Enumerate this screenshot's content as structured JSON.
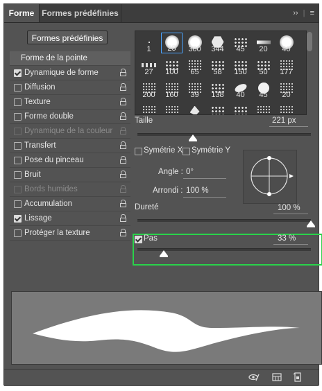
{
  "tabs": [
    {
      "label": "Forme",
      "active": true
    },
    {
      "label": "Formes prédéfinies",
      "active": false
    }
  ],
  "tabbar_icons": {
    "expand": "expand-double-chevron-icon",
    "menu": "panel-menu-icon"
  },
  "preset_button": "Formes prédéfinies",
  "left_list": {
    "header": "Forme de la pointe",
    "items": [
      {
        "label": "Dynamique de forme",
        "checked": true,
        "enabled": true
      },
      {
        "label": "Diffusion",
        "checked": false,
        "enabled": true
      },
      {
        "label": "Texture",
        "checked": false,
        "enabled": true
      },
      {
        "label": "Forme double",
        "checked": false,
        "enabled": true
      },
      {
        "label": "Dynamique de la couleur",
        "checked": false,
        "enabled": false
      },
      {
        "label": "Transfert",
        "checked": false,
        "enabled": true
      },
      {
        "label": "Pose du pinceau",
        "checked": false,
        "enabled": true
      },
      {
        "label": "Bruit",
        "checked": false,
        "enabled": true
      },
      {
        "label": "Bords humides",
        "checked": false,
        "enabled": false
      },
      {
        "label": "Accumulation",
        "checked": false,
        "enabled": true
      },
      {
        "label": "Lissage",
        "checked": true,
        "enabled": true
      },
      {
        "label": "Protéger la texture",
        "checked": false,
        "enabled": true
      }
    ]
  },
  "brush_thumbs": [
    {
      "size": "1"
    },
    {
      "size": "25",
      "selected": true
    },
    {
      "size": "300"
    },
    {
      "size": "344"
    },
    {
      "size": "45"
    },
    {
      "size": "20"
    },
    {
      "size": "40"
    },
    {
      "size": "27"
    },
    {
      "size": "100"
    },
    {
      "size": "65"
    },
    {
      "size": "58"
    },
    {
      "size": "150"
    },
    {
      "size": "50"
    },
    {
      "size": "177"
    },
    {
      "size": "200"
    },
    {
      "size": "160"
    },
    {
      "size": "39"
    },
    {
      "size": "138"
    },
    {
      "size": "40"
    },
    {
      "size": "45"
    },
    {
      "size": "20"
    },
    {
      "size": ""
    },
    {
      "size": ""
    },
    {
      "size": ""
    },
    {
      "size": ""
    },
    {
      "size": ""
    },
    {
      "size": ""
    },
    {
      "size": ""
    }
  ],
  "size": {
    "label": "Taille",
    "value": "221 px",
    "fraction": 0.32
  },
  "symmetry": {
    "x_label": "Symétrie X",
    "y_label": "Symétrie Y",
    "x_checked": false,
    "y_checked": false
  },
  "angle": {
    "label": "Angle :",
    "value": "0°"
  },
  "roundness": {
    "label": "Arrondi :",
    "value": "100 %"
  },
  "hardness": {
    "label": "Dureté",
    "value": "100 %",
    "fraction": 1.0
  },
  "spacing": {
    "label": "Pas",
    "value": "33 %",
    "checked": true,
    "fraction": 0.15
  },
  "bottom_icons": [
    "eye-brush-toggle-icon",
    "grid-panel-icon",
    "new-brush-icon"
  ]
}
